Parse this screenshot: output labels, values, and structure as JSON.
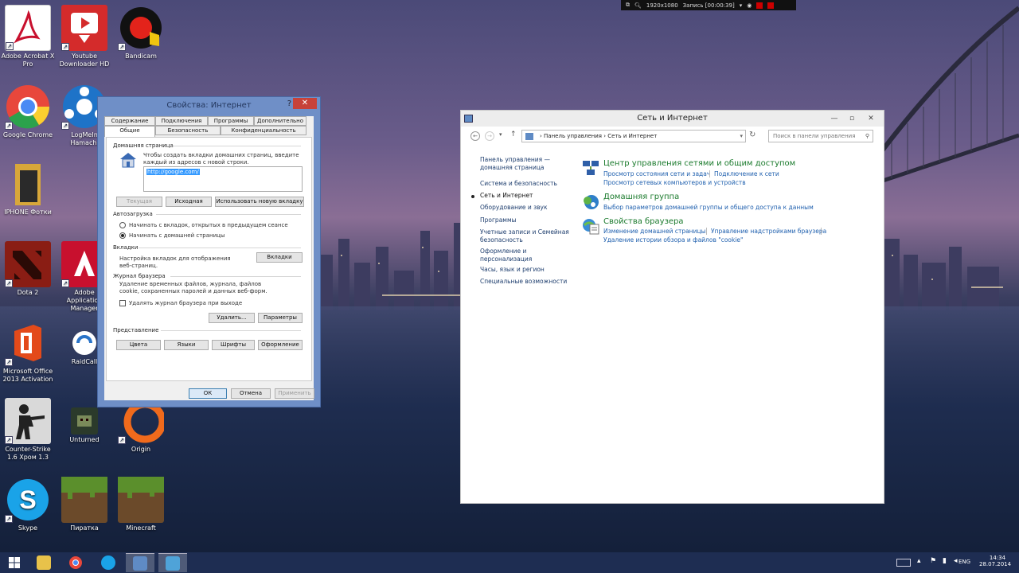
{
  "recorder": {
    "resolution": "1920x1080",
    "record_label": "Запись [00:00:39]"
  },
  "desktop_icons": [
    {
      "label": "Adobe Acrobat X Pro",
      "icon": "adobe-acrobat-icon",
      "color": "#ffffff"
    },
    {
      "label": "Youtube Downloader HD",
      "icon": "youtube-downloader-icon",
      "color": "#d42b2b"
    },
    {
      "label": "Bandicam",
      "icon": "bandicam-icon",
      "color": "#111111"
    },
    {
      "label": "Google Chrome",
      "icon": "chrome-icon",
      "color": "#e8473b"
    },
    {
      "label": "LogMeIn Hamachi",
      "icon": "hamachi-icon",
      "color": "#1e73c8"
    },
    {
      "label": "IPHONE Фотки",
      "icon": "folder-icon",
      "color": "#d8a73a"
    },
    {
      "label": "Dota 2",
      "icon": "dota2-icon",
      "color": "#8a1d14"
    },
    {
      "label": "Adobe Application Manager",
      "icon": "adobe-app-manager-icon",
      "color": "#c8102e"
    },
    {
      "label": "Microsoft Office 2013 Activation",
      "icon": "office-icon",
      "color": "#e34a1a"
    },
    {
      "label": "RaidCall",
      "icon": "raidcall-icon",
      "color": "#ffffff"
    },
    {
      "label": "Counter-Strike 1.6 Хром 1.3",
      "icon": "counter-strike-icon",
      "color": "#d9d9d9"
    },
    {
      "label": "Unturned",
      "icon": "unturned-icon",
      "color": "#2b3a2b"
    },
    {
      "label": "Origin",
      "icon": "origin-icon",
      "color": "#f06a1c"
    },
    {
      "label": "Skype",
      "icon": "skype-icon",
      "color": "#1aa3e8"
    },
    {
      "label": "Пиратка",
      "icon": "minecraft-pirate-icon",
      "color": "#5b8f2c"
    },
    {
      "label": "Minecraft",
      "icon": "minecraft-icon",
      "color": "#5b8f2c"
    }
  ],
  "ie_dialog": {
    "title": "Свойства: Интернет",
    "help": "?",
    "close": "✕",
    "tabs_row1": [
      "Содержание",
      "Подключения",
      "Программы",
      "Дополнительно"
    ],
    "tabs_row2": [
      "Общие",
      "Безопасность",
      "Конфиденциальность"
    ],
    "home_section": "Домашняя страница",
    "home_desc": "Чтобы создать вкладки домашних страниц, введите каждый из адресов с новой строки.",
    "home_url": "http://google.com/",
    "btn_current": "Текущая",
    "btn_default": "Исходная",
    "btn_new_tab": "Использовать новую вкладку",
    "startup_section": "Автозагрузка",
    "radio_prev": "Начинать с вкладок, открытых в предыдущем сеансе",
    "radio_home": "Начинать с домашней страницы",
    "tabs_section": "Вкладки",
    "tabs_desc": "Настройка вкладок для отображения веб-страниц.",
    "btn_tabs": "Вкладки",
    "history_section": "Журнал браузера",
    "history_desc": "Удаление временных файлов, журнала, файлов cookie, сохраненных паролей и данных веб-форм.",
    "chk_delete_on_exit": "Удалять журнал браузера при выходе",
    "btn_delete": "Удалить...",
    "btn_params": "Параметры",
    "appearance_section": "Представление",
    "btn_colors": "Цвета",
    "btn_languages": "Языки",
    "btn_fonts": "Шрифты",
    "btn_design": "Оформление",
    "btn_ok": "ОК",
    "btn_cancel": "Отмена",
    "btn_apply": "Применить"
  },
  "cp_window": {
    "title": "Сеть и Интернет",
    "breadcrumb_root": "Панель управления",
    "breadcrumb_current": "Сеть и Интернет",
    "search_placeholder": "Поиск в панели управления",
    "sidebar": [
      "Панель управления —",
      "домашняя страница",
      "Система и безопасность",
      "Сеть и Интернет",
      "Оборудование и звук",
      "Программы",
      "Учетные записи и Семейная",
      "безопасность",
      "Оформление и",
      "персонализация",
      "Часы, язык и регион",
      "Специальные возможности"
    ],
    "categories": [
      {
        "title": "Центр управления сетями и общим доступом",
        "icon": "network-center-icon",
        "links": [
          "Просмотр состояния сети и задач",
          "Подключение к сети",
          "Просмотр сетевых компьютеров и устройств"
        ]
      },
      {
        "title": "Домашняя группа",
        "icon": "homegroup-icon",
        "links": [
          "Выбор параметров домашней группы и общего доступа к данным"
        ]
      },
      {
        "title": "Свойства браузера",
        "icon": "browser-properties-icon",
        "links": [
          "Изменение домашней страницы",
          "Управление надстройками браузера",
          "Удаление истории обзора и файлов \"cookie\""
        ]
      }
    ]
  },
  "taskbar": {
    "apps": [
      "start-icon",
      "explorer-icon",
      "chrome-icon",
      "skype-icon",
      "control-panel-icon",
      "internet-options-icon"
    ],
    "lang": "ENG",
    "time": "14:34",
    "date": "28.07.2014"
  }
}
